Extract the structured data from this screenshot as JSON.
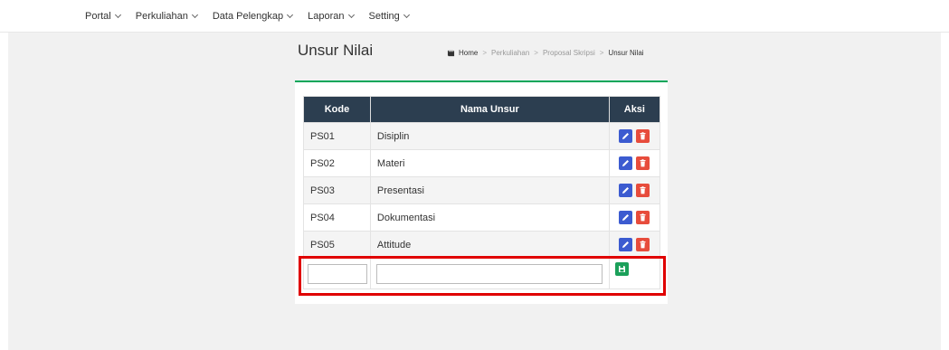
{
  "nav": {
    "items": [
      {
        "label": "Portal"
      },
      {
        "label": "Perkuliahan"
      },
      {
        "label": "Data Pelengkap"
      },
      {
        "label": "Laporan"
      },
      {
        "label": "Setting"
      }
    ]
  },
  "page": {
    "title": "Unsur Nilai"
  },
  "breadcrumb": {
    "home": "Home",
    "sep": ">",
    "level1": "Perkuliahan",
    "level2": "Proposal Skripsi",
    "current": "Unsur Nilai"
  },
  "table": {
    "headers": {
      "kode": "Kode",
      "nama": "Nama Unsur",
      "aksi": "Aksi"
    },
    "rows": [
      {
        "kode": "PS01",
        "nama": "Disiplin"
      },
      {
        "kode": "PS02",
        "nama": "Materi"
      },
      {
        "kode": "PS03",
        "nama": "Presentasi"
      },
      {
        "kode": "PS04",
        "nama": "Dokumentasi"
      },
      {
        "kode": "PS05",
        "nama": "Attitude"
      }
    ],
    "new_row": {
      "kode_value": "",
      "nama_value": ""
    }
  },
  "colors": {
    "header_bg": "#2c3e50",
    "box_accent": "#00a65a",
    "edit_btn": "#3c5bd0",
    "delete_btn": "#e74c3c",
    "save_btn": "#1ba05a",
    "highlight": "#e00000"
  },
  "icons": {
    "edit": "pencil-icon",
    "delete": "trash-icon",
    "save": "floppy-disk-icon",
    "breadcrumb_home": "book-icon",
    "menu_dropdown": "chevron-down-icon"
  }
}
